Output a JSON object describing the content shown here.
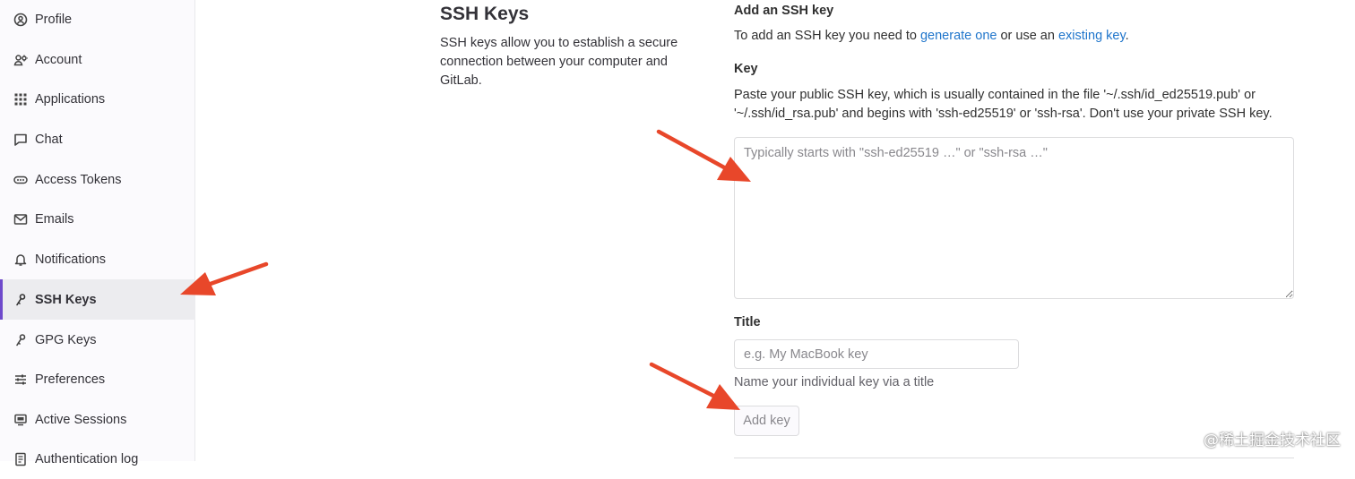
{
  "sidebar": {
    "items": [
      {
        "label": "Profile",
        "icon": "profile-icon",
        "active": false
      },
      {
        "label": "Account",
        "icon": "account-icon",
        "active": false
      },
      {
        "label": "Applications",
        "icon": "applications-icon",
        "active": false
      },
      {
        "label": "Chat",
        "icon": "chat-icon",
        "active": false
      },
      {
        "label": "Access Tokens",
        "icon": "token-icon",
        "active": false
      },
      {
        "label": "Emails",
        "icon": "mail-icon",
        "active": false
      },
      {
        "label": "Notifications",
        "icon": "bell-icon",
        "active": false
      },
      {
        "label": "SSH Keys",
        "icon": "key-icon",
        "active": true
      },
      {
        "label": "GPG Keys",
        "icon": "key-icon",
        "active": false
      },
      {
        "label": "Preferences",
        "icon": "preferences-icon",
        "active": false
      },
      {
        "label": "Active Sessions",
        "icon": "monitor-icon",
        "active": false
      },
      {
        "label": "Authentication log",
        "icon": "log-icon",
        "active": false
      }
    ]
  },
  "section": {
    "title": "SSH Keys",
    "description": "SSH keys allow you to establish a secure connection between your computer and GitLab."
  },
  "form": {
    "heading": "Add an SSH key",
    "intro_prefix": "To add an SSH key you need to ",
    "intro_link1": "generate one",
    "intro_middle": " or use an ",
    "intro_link2": "existing key",
    "intro_suffix": ".",
    "key_label": "Key",
    "key_help": "Paste your public SSH key, which is usually contained in the file '~/.ssh/id_ed25519.pub' or '~/.ssh/id_rsa.pub' and begins with 'ssh-ed25519' or 'ssh-rsa'. Don't use your private SSH key.",
    "key_placeholder": "Typically starts with \"ssh-ed25519 …\" or \"ssh-rsa …\"",
    "key_value": "",
    "title_label": "Title",
    "title_placeholder": "e.g. My MacBook key",
    "title_value": "",
    "title_help": "Name your individual key via a title",
    "submit_label": "Add key"
  },
  "watermark": "@稀土掘金技术社区",
  "colors": {
    "accent": "#6e49cb",
    "link": "#1f75cb",
    "arrow": "#e8472a"
  }
}
